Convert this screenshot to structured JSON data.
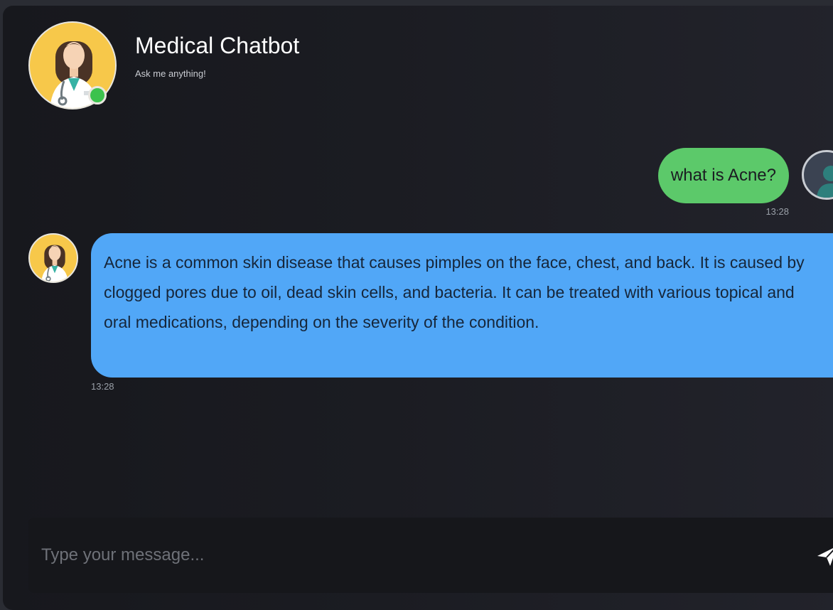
{
  "header": {
    "title": "Medical Chatbot",
    "subtitle": "Ask me anything!",
    "status": "online"
  },
  "messages": [
    {
      "sender": "user",
      "text": "what is Acne?",
      "time": "13:28"
    },
    {
      "sender": "bot",
      "text": "Acne is a common skin disease that causes pimples on the face, chest, and back. It is caused by clogged pores due to oil, dead skin cells, and bacteria. It can be treated with various topical and oral medications, depending on the severity of the condition.",
      "time": "13:28"
    }
  ],
  "composer": {
    "placeholder": "Type your message...",
    "value": ""
  },
  "icons": {
    "bot_avatar": "doctor-avatar-icon",
    "user_avatar": "user-icon",
    "send": "send-icon",
    "status": "online-dot"
  },
  "colors": {
    "user_bubble": "#5cc96a",
    "bot_bubble": "#51a7f7",
    "avatar_bg": "#f7c84a",
    "online": "#3cc24d"
  }
}
